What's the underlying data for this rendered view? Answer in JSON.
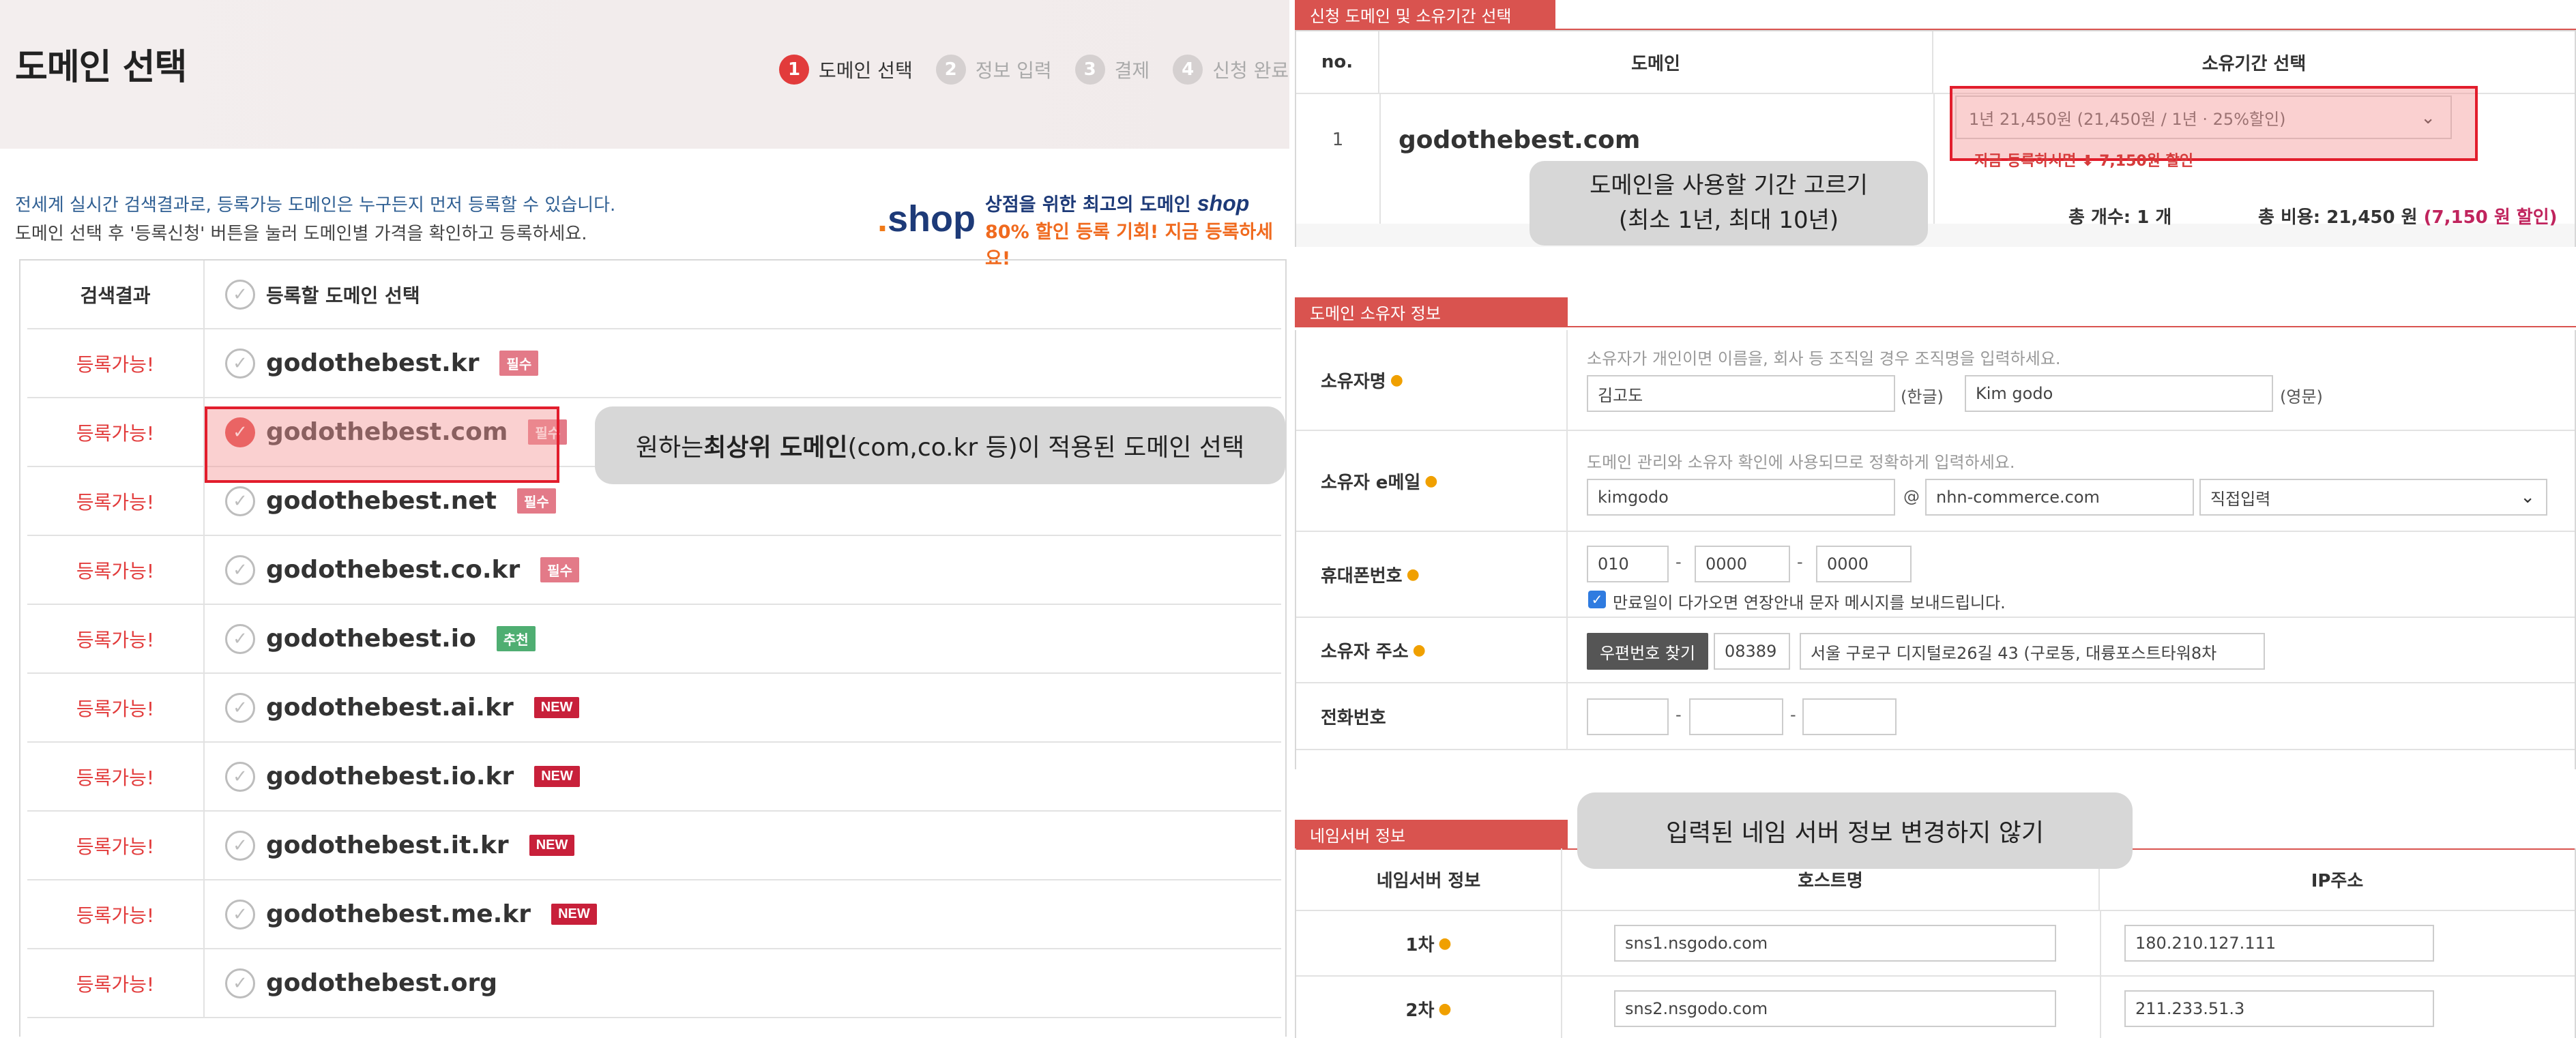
{
  "left": {
    "title": "도메인 선택",
    "steps": [
      {
        "num": "1",
        "label": "도메인 선택"
      },
      {
        "num": "2",
        "label": "정보 입력"
      },
      {
        "num": "3",
        "label": "결제"
      },
      {
        "num": "4",
        "label": "신청 완료"
      }
    ],
    "notice_line1": "전세계 실시간 검색결과로, 등록가능 도메인은 누구든지 먼저 등록할 수 있습니다.",
    "notice_line2": "도메인 선택 후 '등록신청' 버튼을 눌러 도메인별 가격을 확인하고 등록하세요.",
    "shop_banner": {
      "logo": "shop",
      "line1": "상점을 위한 최고의 도메인",
      "brand": "shop",
      "line2": "80% 할인 등록 기회! 지금 등록하세요!"
    },
    "table_header": {
      "status": "검색결과",
      "domain": "등록할 도메인 선택"
    },
    "rows": [
      {
        "status": "등록가능!",
        "domain": "godothebest.kr",
        "badge": "필수",
        "badge_type": "req",
        "checked": false
      },
      {
        "status": "등록가능!",
        "domain": "godothebest.com",
        "badge": "필수",
        "badge_type": "req",
        "checked": true
      },
      {
        "status": "등록가능!",
        "domain": "godothebest.net",
        "badge": "필수",
        "badge_type": "req",
        "checked": false
      },
      {
        "status": "등록가능!",
        "domain": "godothebest.co.kr",
        "badge": "필수",
        "badge_type": "req",
        "checked": false
      },
      {
        "status": "등록가능!",
        "domain": "godothebest.io",
        "badge": "추천",
        "badge_type": "rec",
        "checked": false
      },
      {
        "status": "등록가능!",
        "domain": "godothebest.ai.kr",
        "badge": "NEW",
        "badge_type": "new",
        "checked": false
      },
      {
        "status": "등록가능!",
        "domain": "godothebest.io.kr",
        "badge": "NEW",
        "badge_type": "new",
        "checked": false
      },
      {
        "status": "등록가능!",
        "domain": "godothebest.it.kr",
        "badge": "NEW",
        "badge_type": "new",
        "checked": false
      },
      {
        "status": "등록가능!",
        "domain": "godothebest.me.kr",
        "badge": "NEW",
        "badge_type": "new",
        "checked": false
      },
      {
        "status": "등록가능!",
        "domain": "godothebest.org",
        "badge": "",
        "badge_type": "",
        "checked": false
      }
    ],
    "callout": {
      "pre": "원하는 ",
      "bold": "최상위 도메인",
      "post": "(com,co.kr 등)이 적용된 도메인 선택"
    }
  },
  "right": {
    "period_section": {
      "tab": "신청 도메인 및 소유기간 선택",
      "headers": {
        "no": "no.",
        "domain": "도메인",
        "period": "소유기간 선택"
      },
      "row": {
        "no": "1",
        "domain": "godothebest.com",
        "period_value": "1년 21,450원 (21,450원 / 1년 · 25%할인)",
        "note": "지금 등록하시면 ⬇ 7,150원 할인"
      },
      "total_count": "총 개수: 1 개",
      "total_cost": "총 비용: 21,450 원",
      "total_discount": "(7,150 원 할인)",
      "callout_line1": "도메인을 사용할 기간 고르기",
      "callout_line2": "(최소 1년, 최대 10년)"
    },
    "owner_section": {
      "tab": "도메인 소유자 정보",
      "name": {
        "label": "소유자명",
        "hint": "소유자가 개인이면 이름을, 회사 등 조직일 경우 조직명을 입력하세요.",
        "korean_value": "김고도",
        "korean_suffix": "(한글)",
        "english_value": "Kim godo",
        "english_suffix": "(영문)"
      },
      "email": {
        "label": "소유자 e메일",
        "hint": "도메인 관리와 소유자 확인에 사용되므로 정확하게 입력하세요.",
        "local": "kimgodo",
        "at": "@",
        "domain": "nhn-commerce.com",
        "select": "직접입력"
      },
      "mobile": {
        "label": "휴대폰번호",
        "p1": "010",
        "p2": "0000",
        "p3": "0000",
        "dash": "-",
        "sms_label": "만료일이 다가오면 연장안내 문자 메시지를 보내드립니다."
      },
      "address": {
        "label": "소유자 주소",
        "zip_button": "우편번호 찾기",
        "zip": "08389",
        "address": "서울 구로구 디지털로26길 43 (구로동, 대륭포스트타워8차"
      },
      "phone": {
        "label": "전화번호",
        "p1": "",
        "p2": "",
        "p3": ""
      }
    },
    "ns_section": {
      "tab": "네임서버 정보",
      "headers": {
        "label": "네임서버 정보",
        "host": "호스트명",
        "ip": "IP주소"
      },
      "rows": [
        {
          "label": "1차",
          "host": "sns1.nsgodo.com",
          "ip": "180.210.127.111"
        },
        {
          "label": "2차",
          "host": "sns2.nsgodo.com",
          "ip": "211.233.51.3"
        }
      ],
      "callout": "입력된 네임 서버 정보 변경하지 않기"
    }
  },
  "colors": {
    "accent_red": "#e23b3b",
    "section_tab": "#d9534f",
    "highlight_border": "#e21d2c",
    "link_blue": "#2f5f93",
    "discount_magenta": "#c0245d"
  }
}
